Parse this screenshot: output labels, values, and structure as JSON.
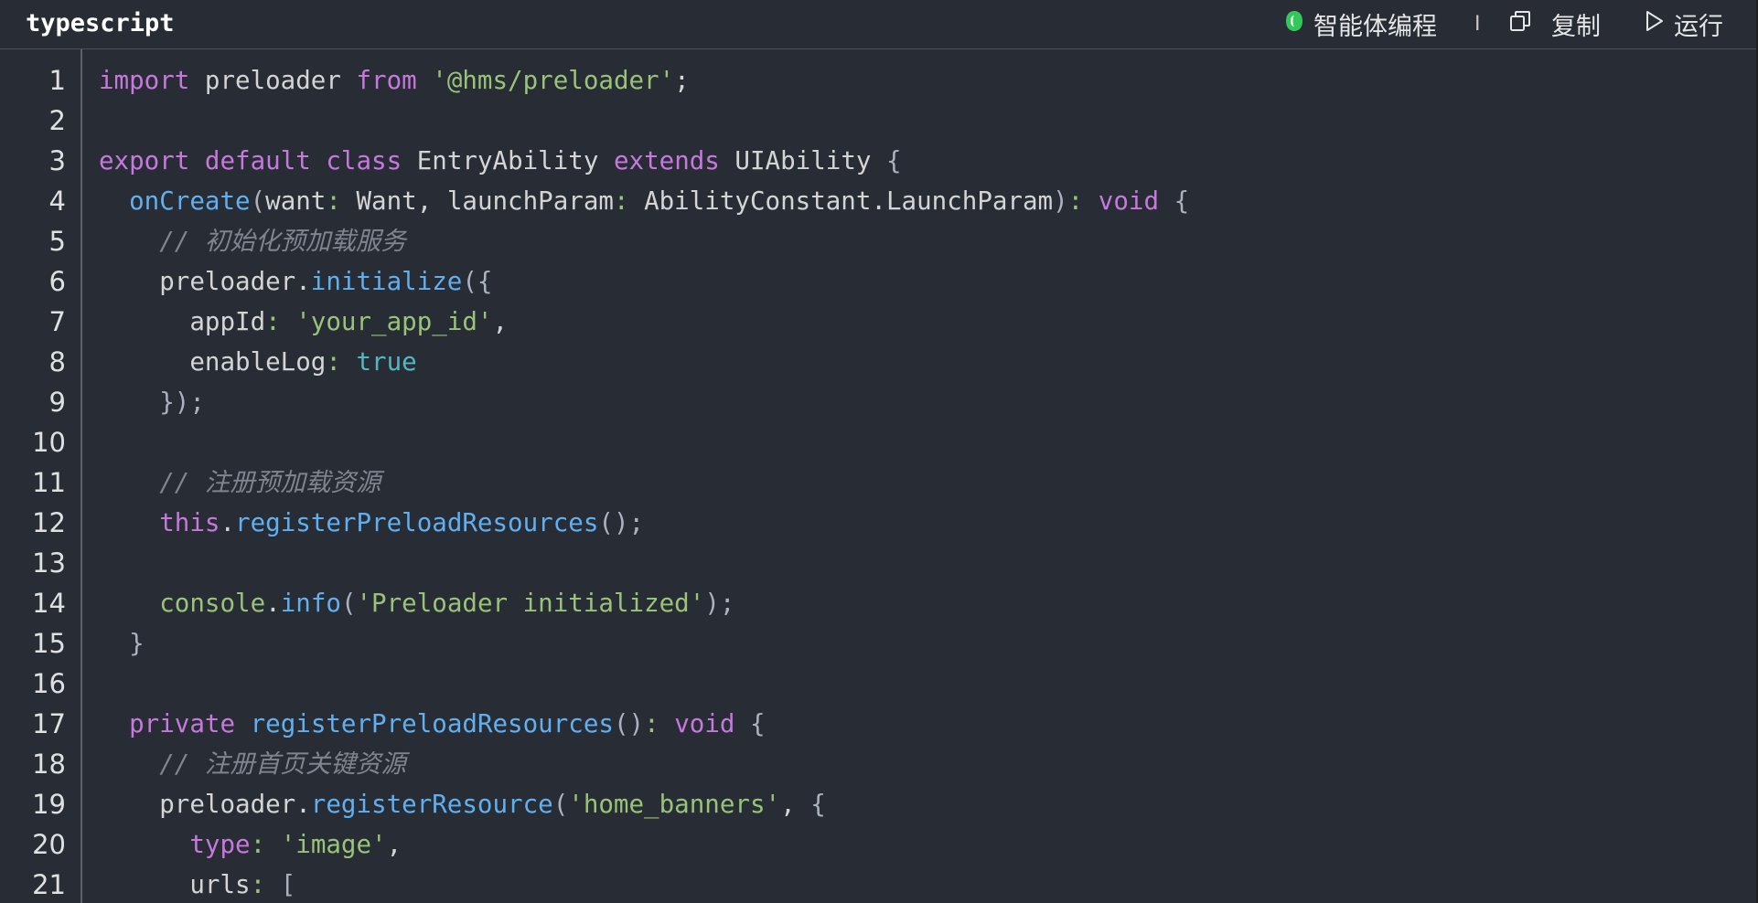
{
  "header": {
    "language": "typescript",
    "agent_label": "智能体编程",
    "separator": "I",
    "copy_label": "复制",
    "run_label": "运行"
  },
  "colors": {
    "background": "#282c34",
    "keyword": "#c678dd",
    "string": "#98c379",
    "function": "#61afef",
    "comment": "#7f848e",
    "boolean": "#56b6c2",
    "agent_icon": "#34c759"
  },
  "icons": {
    "agent": "agent-logo-icon",
    "copy": "copy-icon",
    "run": "play-icon"
  },
  "code": {
    "lines": [
      [
        [
          "kw",
          "import"
        ],
        [
          "pl",
          " preloader "
        ],
        [
          "kw",
          "from"
        ],
        [
          "pl",
          " "
        ],
        [
          "str",
          "'@hms/preloader'"
        ],
        [
          "pl",
          ";"
        ]
      ],
      [],
      [
        [
          "kw",
          "export"
        ],
        [
          "pl",
          " "
        ],
        [
          "kw",
          "default"
        ],
        [
          "pl",
          " "
        ],
        [
          "kw",
          "class"
        ],
        [
          "pl",
          " EntryAbility "
        ],
        [
          "kw",
          "extends"
        ],
        [
          "pl",
          " UIAbility "
        ],
        [
          "br",
          "{"
        ]
      ],
      [
        [
          "pl",
          "  "
        ],
        [
          "fn",
          "onCreate"
        ],
        [
          "br",
          "("
        ],
        [
          "pl",
          "want"
        ],
        [
          "op",
          ":"
        ],
        [
          "pl",
          " Want, launchParam"
        ],
        [
          "op",
          ":"
        ],
        [
          "pl",
          " AbilityConstant.LaunchParam"
        ],
        [
          "br",
          ")"
        ],
        [
          "op",
          ":"
        ],
        [
          "pl",
          " "
        ],
        [
          "kw",
          "void"
        ],
        [
          "pl",
          " "
        ],
        [
          "br",
          "{"
        ]
      ],
      [
        [
          "pl",
          "    "
        ],
        [
          "cm",
          "// 初始化预加载服务"
        ]
      ],
      [
        [
          "pl",
          "    preloader."
        ],
        [
          "fn",
          "initialize"
        ],
        [
          "br",
          "({"
        ]
      ],
      [
        [
          "pl",
          "      appId"
        ],
        [
          "op",
          ":"
        ],
        [
          "pl",
          " "
        ],
        [
          "str",
          "'your_app_id'"
        ],
        [
          "pl",
          ","
        ]
      ],
      [
        [
          "pl",
          "      enableLog"
        ],
        [
          "op",
          ":"
        ],
        [
          "pl",
          " "
        ],
        [
          "bool",
          "true"
        ]
      ],
      [
        [
          "pl",
          "    "
        ],
        [
          "br",
          "});"
        ]
      ],
      [],
      [
        [
          "pl",
          "    "
        ],
        [
          "cm",
          "// 注册预加载资源"
        ]
      ],
      [
        [
          "pl",
          "    "
        ],
        [
          "kw",
          "this"
        ],
        [
          "pl",
          "."
        ],
        [
          "fn",
          "registerPreloadResources"
        ],
        [
          "br",
          "();"
        ]
      ],
      [],
      [
        [
          "pl",
          "    "
        ],
        [
          "str",
          "console"
        ],
        [
          "pl",
          "."
        ],
        [
          "fn",
          "info"
        ],
        [
          "br",
          "("
        ],
        [
          "str",
          "'Preloader initialized'"
        ],
        [
          "br",
          ");"
        ]
      ],
      [
        [
          "pl",
          "  "
        ],
        [
          "br",
          "}"
        ]
      ],
      [],
      [
        [
          "pl",
          "  "
        ],
        [
          "kw",
          "private"
        ],
        [
          "pl",
          " "
        ],
        [
          "fn",
          "registerPreloadResources"
        ],
        [
          "br",
          "()"
        ],
        [
          "op",
          ":"
        ],
        [
          "pl",
          " "
        ],
        [
          "kw",
          "void"
        ],
        [
          "pl",
          " "
        ],
        [
          "br",
          "{"
        ]
      ],
      [
        [
          "pl",
          "    "
        ],
        [
          "cm",
          "// 注册首页关键资源"
        ]
      ],
      [
        [
          "pl",
          "    preloader."
        ],
        [
          "fn",
          "registerResource"
        ],
        [
          "br",
          "("
        ],
        [
          "str",
          "'home_banners'"
        ],
        [
          "pl",
          ", "
        ],
        [
          "br",
          "{"
        ]
      ],
      [
        [
          "pl",
          "      "
        ],
        [
          "kw",
          "type"
        ],
        [
          "op",
          ":"
        ],
        [
          "pl",
          " "
        ],
        [
          "str",
          "'image'"
        ],
        [
          "pl",
          ","
        ]
      ],
      [
        [
          "pl",
          "      urls"
        ],
        [
          "op",
          ":"
        ],
        [
          "pl",
          " "
        ],
        [
          "br",
          "["
        ]
      ]
    ]
  }
}
